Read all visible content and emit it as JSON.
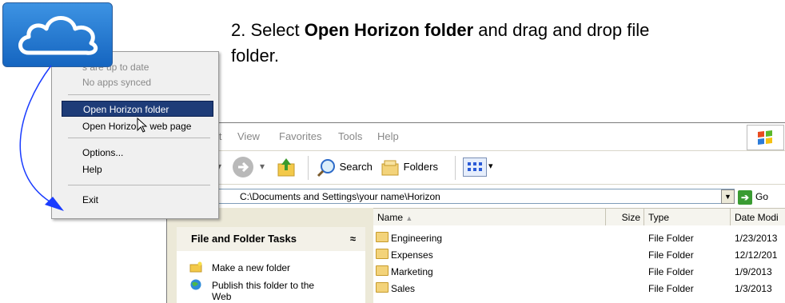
{
  "instruction": {
    "step_prefix": "2. Select ",
    "bold_text": "Open Horizon folder",
    "suffix": " and drag and drop file",
    "line2": "folder."
  },
  "context_menu": {
    "items": [
      {
        "label": "Apps are up to date",
        "visible_text": "s are up to date",
        "disabled": true
      },
      {
        "label": "No apps synced",
        "disabled": true
      },
      {
        "label": "Open Horizon folder",
        "selected": true
      },
      {
        "label": "Open Horizon web page",
        "visible_text": "Open Horizo",
        "visible_text_tail": "web page"
      },
      {
        "label": "Options..."
      },
      {
        "label": "Help"
      },
      {
        "label": "Exit"
      }
    ]
  },
  "explorer": {
    "menu": [
      "it",
      "View",
      "Favorites",
      "Tools",
      "Help"
    ],
    "toolbar": {
      "search_label": "Search",
      "folders_label": "Folders"
    },
    "address": "C:\\Documents and Settings\\your name\\Horizon",
    "go_label": "Go",
    "columns": [
      "Name",
      "Size",
      "Type",
      "Date Modi"
    ],
    "task_pane": {
      "title": "File and Folder Tasks",
      "collapse": "≈",
      "tasks": [
        "Make a new folder",
        "Publish this folder to the",
        "Web"
      ]
    },
    "files": [
      {
        "name": "Engineering",
        "type": "File Folder",
        "date": "1/23/2013"
      },
      {
        "name": "Expenses",
        "type": "File Folder",
        "date": "12/12/201"
      },
      {
        "name": "Marketing",
        "type": "File Folder",
        "date": "1/9/2013"
      },
      {
        "name": "Sales",
        "type": "File Folder",
        "date": "1/3/2013"
      }
    ]
  },
  "colors": {
    "menu_highlight": "#1e3c78",
    "logo_blue": "#1565c0",
    "arrow_blue": "#1a3cff"
  },
  "icons": [
    "cloud-logo-icon",
    "mouse-cursor-icon",
    "back-arrow-icon",
    "forward-arrow-icon",
    "up-folder-icon",
    "search-icon",
    "folders-icon",
    "views-icon",
    "go-arrow-icon",
    "folder-icon",
    "windows-logo-icon",
    "new-folder-icon",
    "publish-icon"
  ]
}
